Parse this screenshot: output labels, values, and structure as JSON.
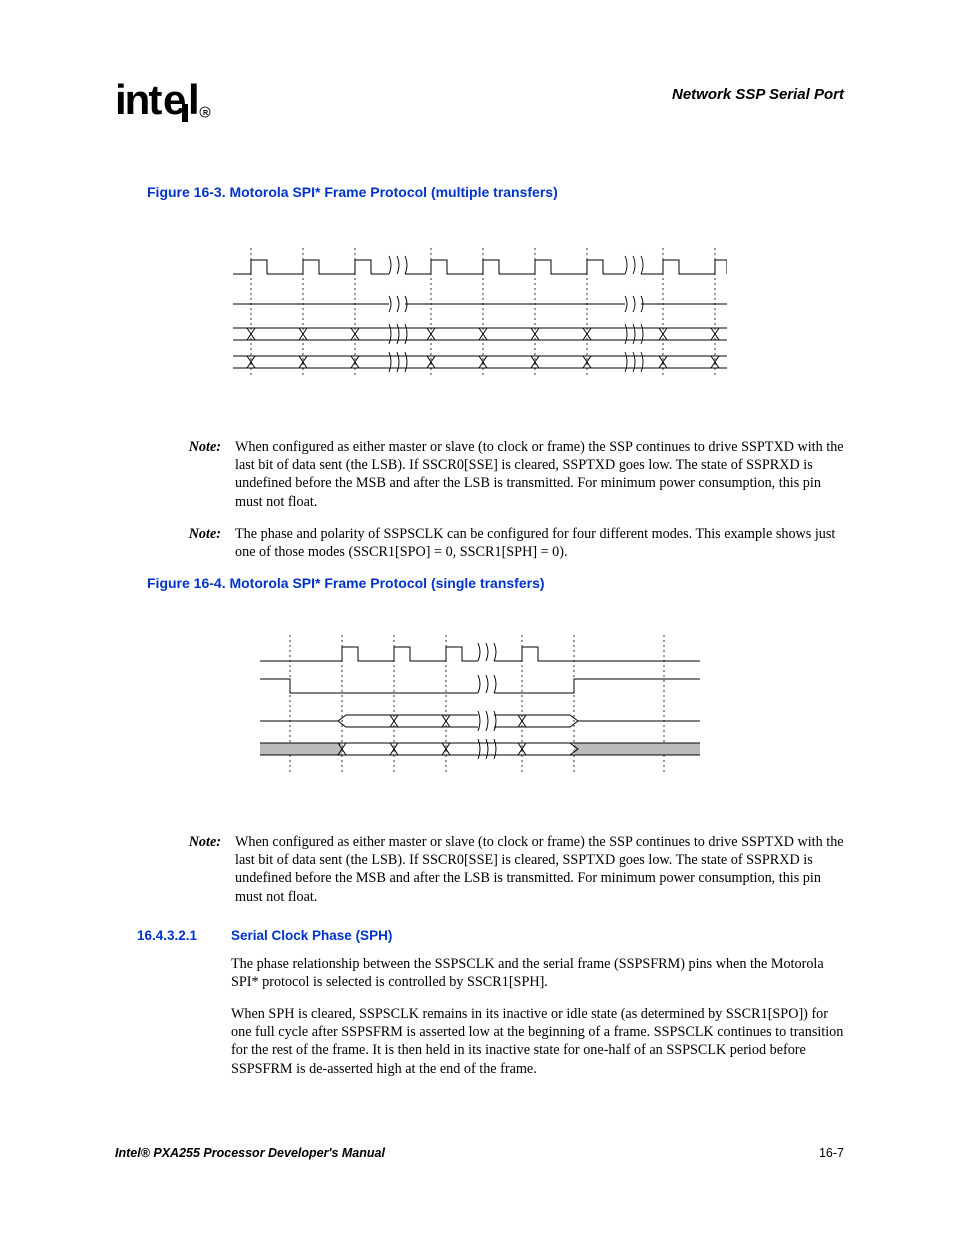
{
  "header": {
    "logo_text": "intel",
    "right_title": "Network SSP Serial Port"
  },
  "figure1": {
    "title": "Figure 16-3. Motorola SPI* Frame Protocol (multiple transfers)"
  },
  "note1": {
    "label": "Note:",
    "body": "When configured as either master or slave (to clock or frame) the SSP continues to drive SSPTXD with the last bit of data sent (the LSB). If SSCR0[SSE] is cleared, SSPTXD goes low. The state of SSPRXD is undefined before the MSB and after the LSB is transmitted. For minimum power consumption, this pin must not float."
  },
  "note2": {
    "label": "Note:",
    "body": "The phase and polarity of SSPSCLK can be configured for four different modes. This example shows just one of those modes (SSCR1[SPO] = 0, SSCR1[SPH] = 0)."
  },
  "figure2": {
    "title": "Figure 16-4. Motorola SPI* Frame Protocol (single transfers)"
  },
  "note3": {
    "label": "Note:",
    "body": "When configured as either master or slave (to clock or frame) the SSP continues to drive SSPTXD with the last bit of data sent (the LSB). If SSCR0[SSE] is cleared, SSPTXD goes low. The state of SSPRXD is undefined before the MSB and after the LSB is transmitted. For minimum power consumption, this pin must not float."
  },
  "section": {
    "number": "16.4.3.2.1",
    "title": "Serial Clock Phase (SPH)"
  },
  "para1": "The phase relationship between the SSPSCLK and the serial frame (SSPSFRM) pins when the Motorola SPI* protocol is selected is controlled by SSCR1[SPH].",
  "para2": "When SPH is cleared, SSPSCLK remains in its inactive or idle state (as determined by SSCR1[SPO]) for one full cycle after SSPSFRM is asserted low at the beginning of a frame. SSPSCLK continues to transition for the rest of the frame. It is then held in its inactive state for one-half of an SSPSCLK period before SSPSFRM is de-asserted high at the end of the frame.",
  "footer": {
    "left": "Intel® PXA255 Processor Developer's Manual",
    "right": "16-7"
  }
}
